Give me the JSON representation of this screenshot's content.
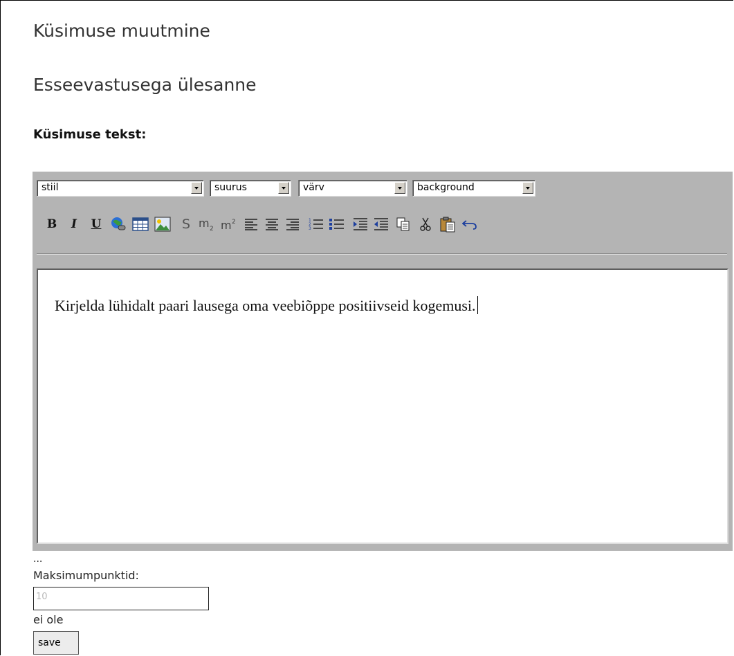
{
  "page": {
    "title": "Küsimuse muutmine",
    "subtitle": "Esseevastusega ülesanne",
    "question_label": "Küsimuse tekst:"
  },
  "editor": {
    "selects": {
      "style": "stiil",
      "size": "suurus",
      "color": "värv",
      "background": "background"
    },
    "buttons": {
      "bold": "B",
      "italic": "I",
      "underline": "U",
      "strike": "S"
    },
    "icons": [
      "bold-icon",
      "italic-icon",
      "underline-icon",
      "link-icon",
      "table-icon",
      "image-icon",
      "strikethrough-icon",
      "subscript-icon",
      "superscript-icon",
      "align-left-icon",
      "align-center-icon",
      "align-right-icon",
      "ordered-list-icon",
      "unordered-list-icon",
      "indent-icon",
      "outdent-icon",
      "copy-icon",
      "cut-icon",
      "paste-icon",
      "undo-icon"
    ],
    "content": "Kirjelda lühidalt paari lausega oma veebiõppe positiivseid kogemusi."
  },
  "form": {
    "ellipsis": "...",
    "max_points_label": "Maksimumpunktid:",
    "max_points_value": "10",
    "status_text": "ei ole",
    "save_label": "save"
  },
  "colors": {
    "toolbar_bg": "#b4b4b4",
    "button_bg": "#ececec"
  }
}
